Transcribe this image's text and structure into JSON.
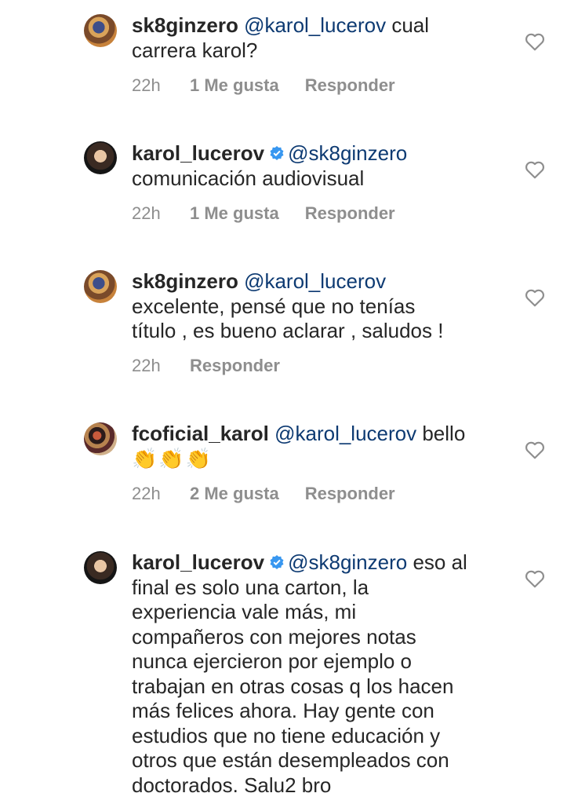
{
  "comments": [
    {
      "username": "sk8ginzero",
      "verified": false,
      "mention": "@karol_lucerov",
      "text_lines": [
        " cual",
        "carrera karol?"
      ],
      "time": "22h",
      "likes": "1 Me gusta",
      "reply": "Responder"
    },
    {
      "username": "karol_lucerov",
      "verified": true,
      "mention": "@sk8ginzero",
      "text_lines": [
        "comunicación audiovisual"
      ],
      "time": "22h",
      "likes": "1 Me gusta",
      "reply": "Responder"
    },
    {
      "username": "sk8ginzero",
      "verified": false,
      "mention": "@karol_lucerov",
      "text_lines": [
        "excelente, pensé que no tenías",
        "título , es bueno aclarar , saludos !"
      ],
      "time": "22h",
      "likes": "",
      "reply": "Responder"
    },
    {
      "username": "fcoficial_karol",
      "verified": false,
      "mention": "@karol_lucerov",
      "text_lines": [
        " bello",
        "👏👏👏"
      ],
      "time": "22h",
      "likes": "2 Me gusta",
      "reply": "Responder"
    },
    {
      "username": "karol_lucerov",
      "verified": true,
      "mention": "@sk8ginzero",
      "text_lines": [
        " eso al",
        "final es solo una carton, la",
        "experiencia vale más, mi",
        "compañeros con mejores notas",
        "nunca ejercieron por ejemplo o",
        "trabajan en otras cosas q los hacen",
        "más felices ahora. Hay gente con",
        "estudios que no tiene educación y",
        "otros que están desempleados con",
        "doctorados. Salu2 bro"
      ]
    }
  ],
  "icons": {
    "heart": "heart-outline-icon",
    "verified": "verified-badge-icon"
  },
  "colors": {
    "mention": "#0d3a72",
    "meta": "#8e8e8e",
    "verified": "#3897f0"
  }
}
